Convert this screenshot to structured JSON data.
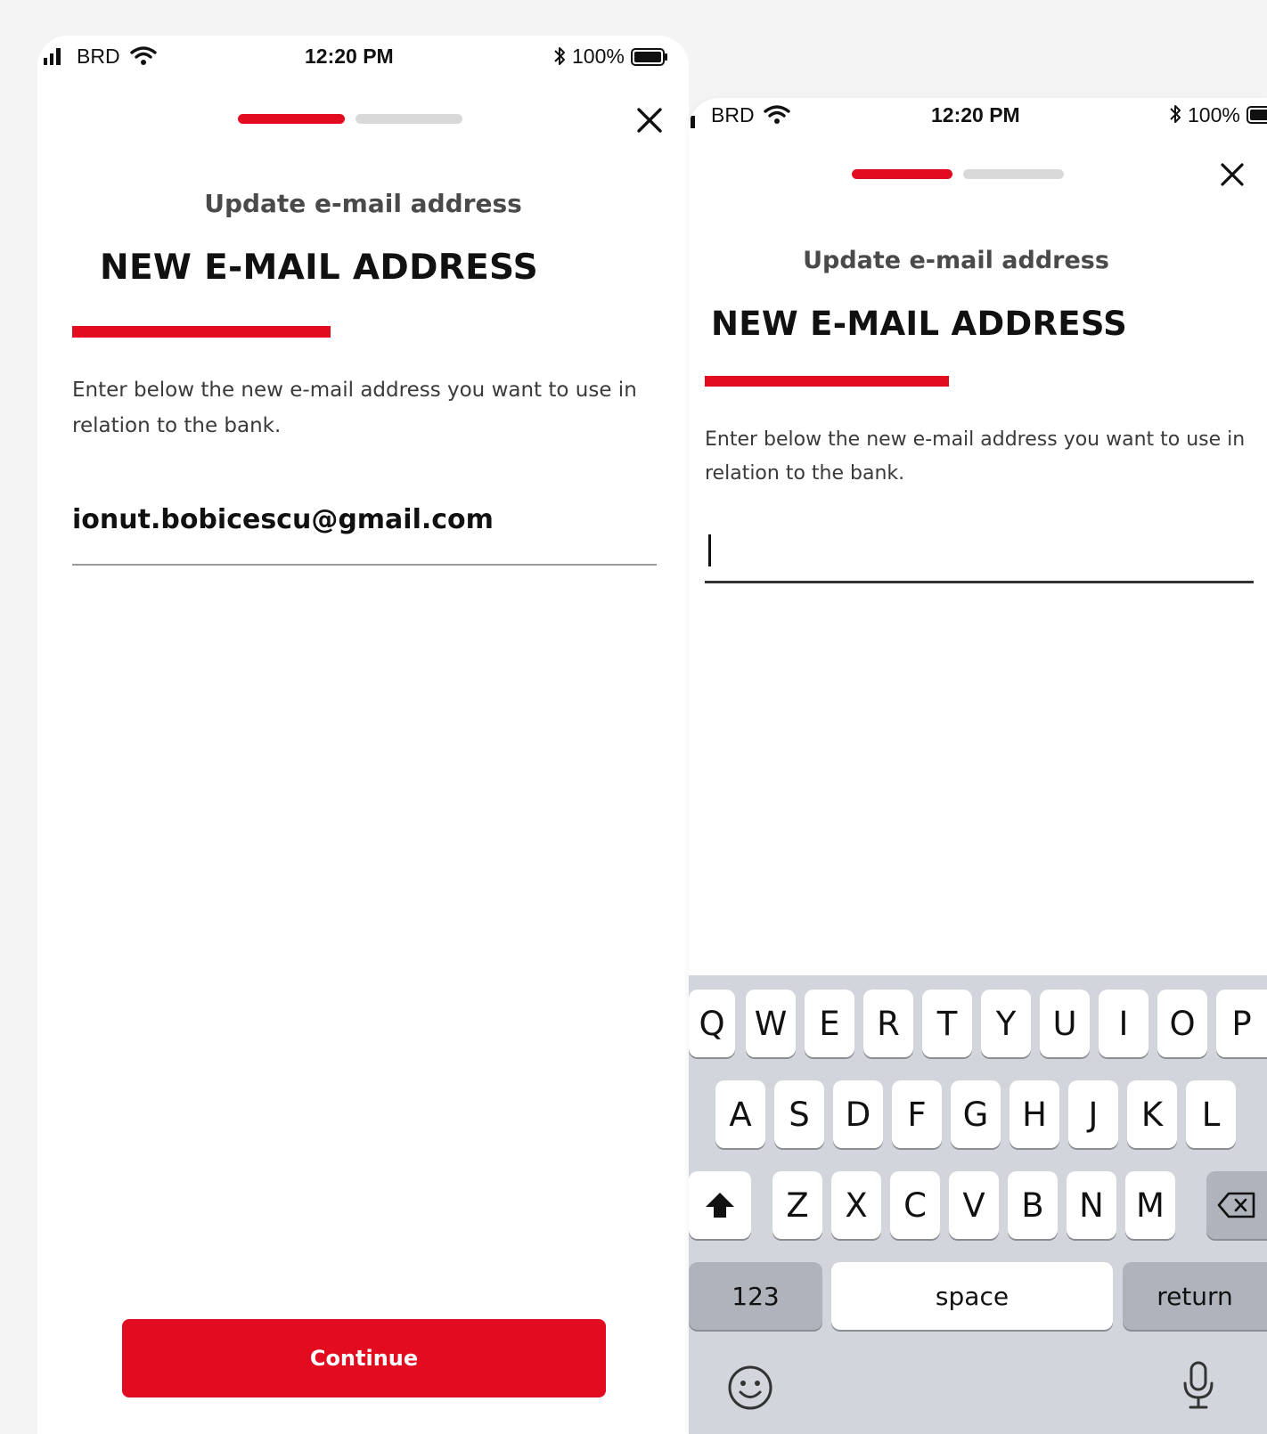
{
  "screens": [
    {
      "status_bar": {
        "carrier": "BRD",
        "time": "12:20 PM",
        "battery": "100%"
      },
      "progress": {
        "current_step": 1,
        "total_steps": 2
      },
      "subtitle": "Update e-mail address",
      "heading": "NEW E-MAIL ADDRESS",
      "description": "Enter below the new e-mail address you want to use in relation to the bank.",
      "email_value": "ionut.bobicescu@gmail.com",
      "continue_label": "Continue"
    },
    {
      "status_bar": {
        "carrier": "BRD",
        "time": "12:20 PM",
        "battery": "100%"
      },
      "progress": {
        "current_step": 1,
        "total_steps": 2
      },
      "subtitle": "Update e-mail address",
      "heading": "NEW E-MAIL ADDRESS",
      "description": "Enter below the new e-mail address you want to use in relation to the bank.",
      "email_value": "",
      "keyboard": {
        "row1": [
          "Q",
          "W",
          "E",
          "R",
          "T",
          "Y",
          "U",
          "I",
          "O",
          "P"
        ],
        "row2": [
          "A",
          "S",
          "D",
          "F",
          "G",
          "H",
          "J",
          "K",
          "L"
        ],
        "row3": [
          "Z",
          "X",
          "C",
          "V",
          "B",
          "N",
          "M"
        ],
        "numbers_label": "123",
        "space_label": "space",
        "return_label": "return"
      }
    }
  ],
  "colors": {
    "accent": "#e30b1f",
    "progress_inactive": "#d9d9d9",
    "keyboard_bg": "#d2d5db",
    "page_bg": "#f4f4f5"
  },
  "icons": [
    "signal-icon",
    "wifi-icon",
    "bluetooth-icon",
    "battery-icon",
    "close-icon",
    "shift-icon",
    "backspace-icon",
    "emoji-icon",
    "microphone-icon"
  ]
}
